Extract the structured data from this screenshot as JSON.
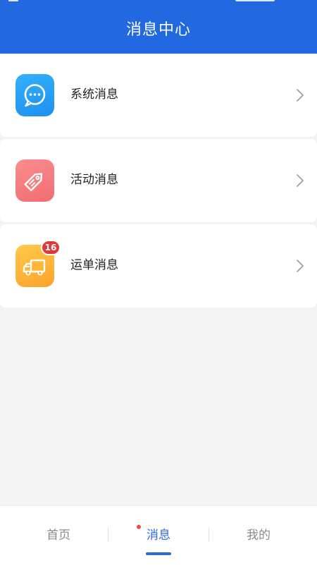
{
  "header": {
    "title": "消息中心"
  },
  "messages": {
    "items": [
      {
        "label": "系统消息",
        "icon": "chat-bubble-icon",
        "color": "#1e8ff0"
      },
      {
        "label": "活动消息",
        "icon": "tag-icon",
        "color": "#f06d72"
      },
      {
        "label": "运单消息",
        "icon": "truck-icon",
        "color": "#fca42a",
        "badge": "16"
      }
    ]
  },
  "tabbar": {
    "tabs": [
      {
        "label": "首页"
      },
      {
        "label": "消息",
        "active": true
      },
      {
        "label": "我的"
      }
    ],
    "active_color": "#2a6adf"
  },
  "colors": {
    "header_bg": "#2268e0",
    "page_bg": "#f3f3f3",
    "badge_bg": "#de3a37"
  }
}
